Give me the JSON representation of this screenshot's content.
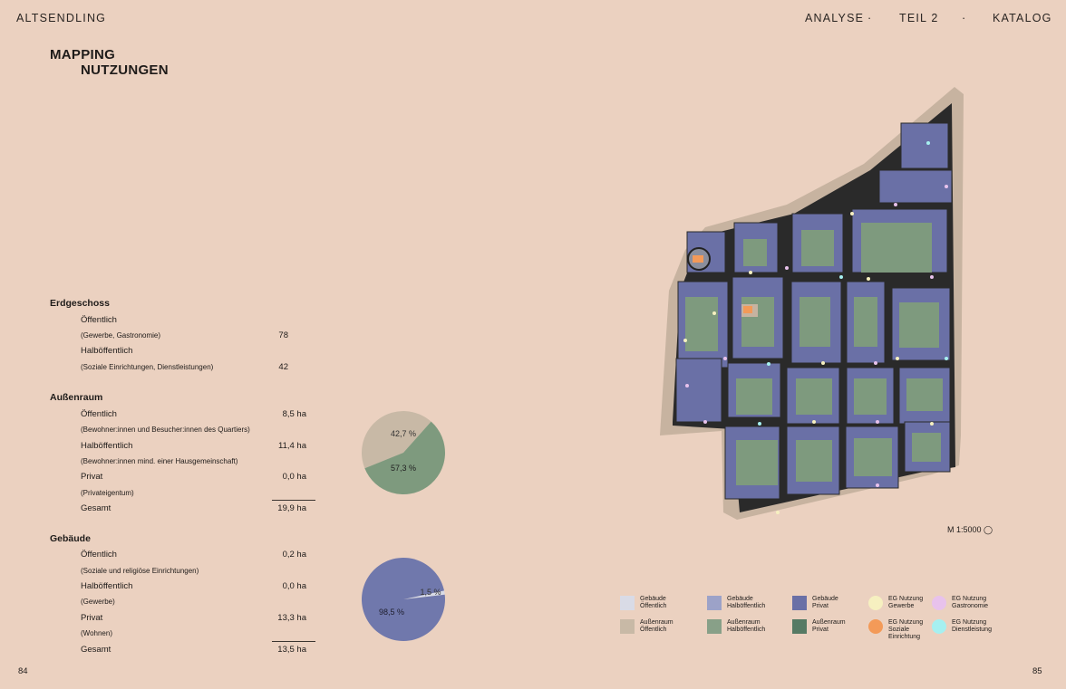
{
  "header": {
    "left": "ALTSENDLING",
    "nav": [
      "ANALYSE",
      "·",
      "TEIL 2",
      "·",
      "KATALOG"
    ]
  },
  "title": {
    "line1": "MAPPING",
    "line2": "NUTZUNGEN"
  },
  "erdgeschoss": {
    "heading": "Erdgeschoss",
    "rows": [
      {
        "label": "Öffentlich",
        "value": ""
      },
      {
        "label": "(Gewerbe, Gastronomie)",
        "value": "78"
      },
      {
        "label": "Halböffentlich",
        "value": ""
      },
      {
        "label": "(Soziale Einrichtungen, Dienstleistungen)",
        "value": "42"
      }
    ]
  },
  "aussenraum": {
    "heading": "Außenraum",
    "rows": [
      {
        "label": "Öffentlich",
        "value": "8,5 ha"
      },
      {
        "label": "(Bewohner:innen und Besucher:innen des Quartiers)",
        "value": ""
      },
      {
        "label": "Halböffentlich",
        "value": "11,4 ha"
      },
      {
        "label": "(Bewohner:innen mind. einer Hausgemeinschaft)",
        "value": ""
      },
      {
        "label": "Privat",
        "value": "0,0 ha"
      },
      {
        "label": "(Privateigentum)",
        "value": ""
      },
      {
        "label": "Gesamt",
        "value": "19,9 ha"
      }
    ],
    "pie": [
      {
        "label": "42,7 %",
        "value": 42.7,
        "color": "#c8b9a6"
      },
      {
        "label": "57,3 %",
        "value": 57.3,
        "color": "#7e9a7e"
      }
    ]
  },
  "gebaeude": {
    "heading": "Gebäude",
    "rows": [
      {
        "label": "Öffentlich",
        "value": "0,2 ha"
      },
      {
        "label": "(Soziale und religiöse Einrichtungen)",
        "value": ""
      },
      {
        "label": "Halböffentlich",
        "value": "0,0 ha"
      },
      {
        "label": "(Gewerbe)",
        "value": ""
      },
      {
        "label": "Privat",
        "value": "13,3 ha"
      },
      {
        "label": "(Wohnen)",
        "value": ""
      },
      {
        "label": "Gesamt",
        "value": "13,5 ha"
      }
    ],
    "pie": [
      {
        "label": "1,5 %",
        "value": 1.5,
        "color": "#d8dbe6"
      },
      {
        "label": "98,5 %",
        "value": 98.5,
        "color": "#7078ac"
      }
    ]
  },
  "scale": "M 1:5000",
  "legend": [
    {
      "line1": "Gebäude",
      "line2": "Öffentlich",
      "line3": "",
      "color": "#d9dbe6",
      "shape": "square"
    },
    {
      "line1": "Gebäude",
      "line2": "Halböffentlich",
      "line3": "",
      "color": "#9ca2c8",
      "shape": "square"
    },
    {
      "line1": "Gebäude",
      "line2": "Privat",
      "line3": "",
      "color": "#6a70a6",
      "shape": "square"
    },
    {
      "line1": "EG Nutzung",
      "line2": "Gewerbe",
      "line3": "",
      "color": "#f6f0c0",
      "shape": "circle"
    },
    {
      "line1": "EG Nutzung",
      "line2": "Gastronomie",
      "line3": "",
      "color": "#e8c2ec",
      "shape": "circle"
    },
    {
      "line1": "Außenraum",
      "line2": "Öffentlich",
      "line3": "",
      "color": "#c8b9a6",
      "shape": "square"
    },
    {
      "line1": "Außenraum",
      "line2": "Halböffentlich",
      "line3": "",
      "color": "#88a088",
      "shape": "square"
    },
    {
      "line1": "Außenraum",
      "line2": "Privat",
      "line3": "",
      "color": "#567a64",
      "shape": "square"
    },
    {
      "line1": "EG Nutzung",
      "line2": "Soziale",
      "line3": "Einrichtung",
      "color": "#f39a58",
      "shape": "circle"
    },
    {
      "line1": "EG Nutzung",
      "line2": "Dienstleistung",
      "line3": "",
      "color": "#a6f0f0",
      "shape": "circle"
    }
  ],
  "page_numbers": {
    "left": "84",
    "right": "85"
  }
}
